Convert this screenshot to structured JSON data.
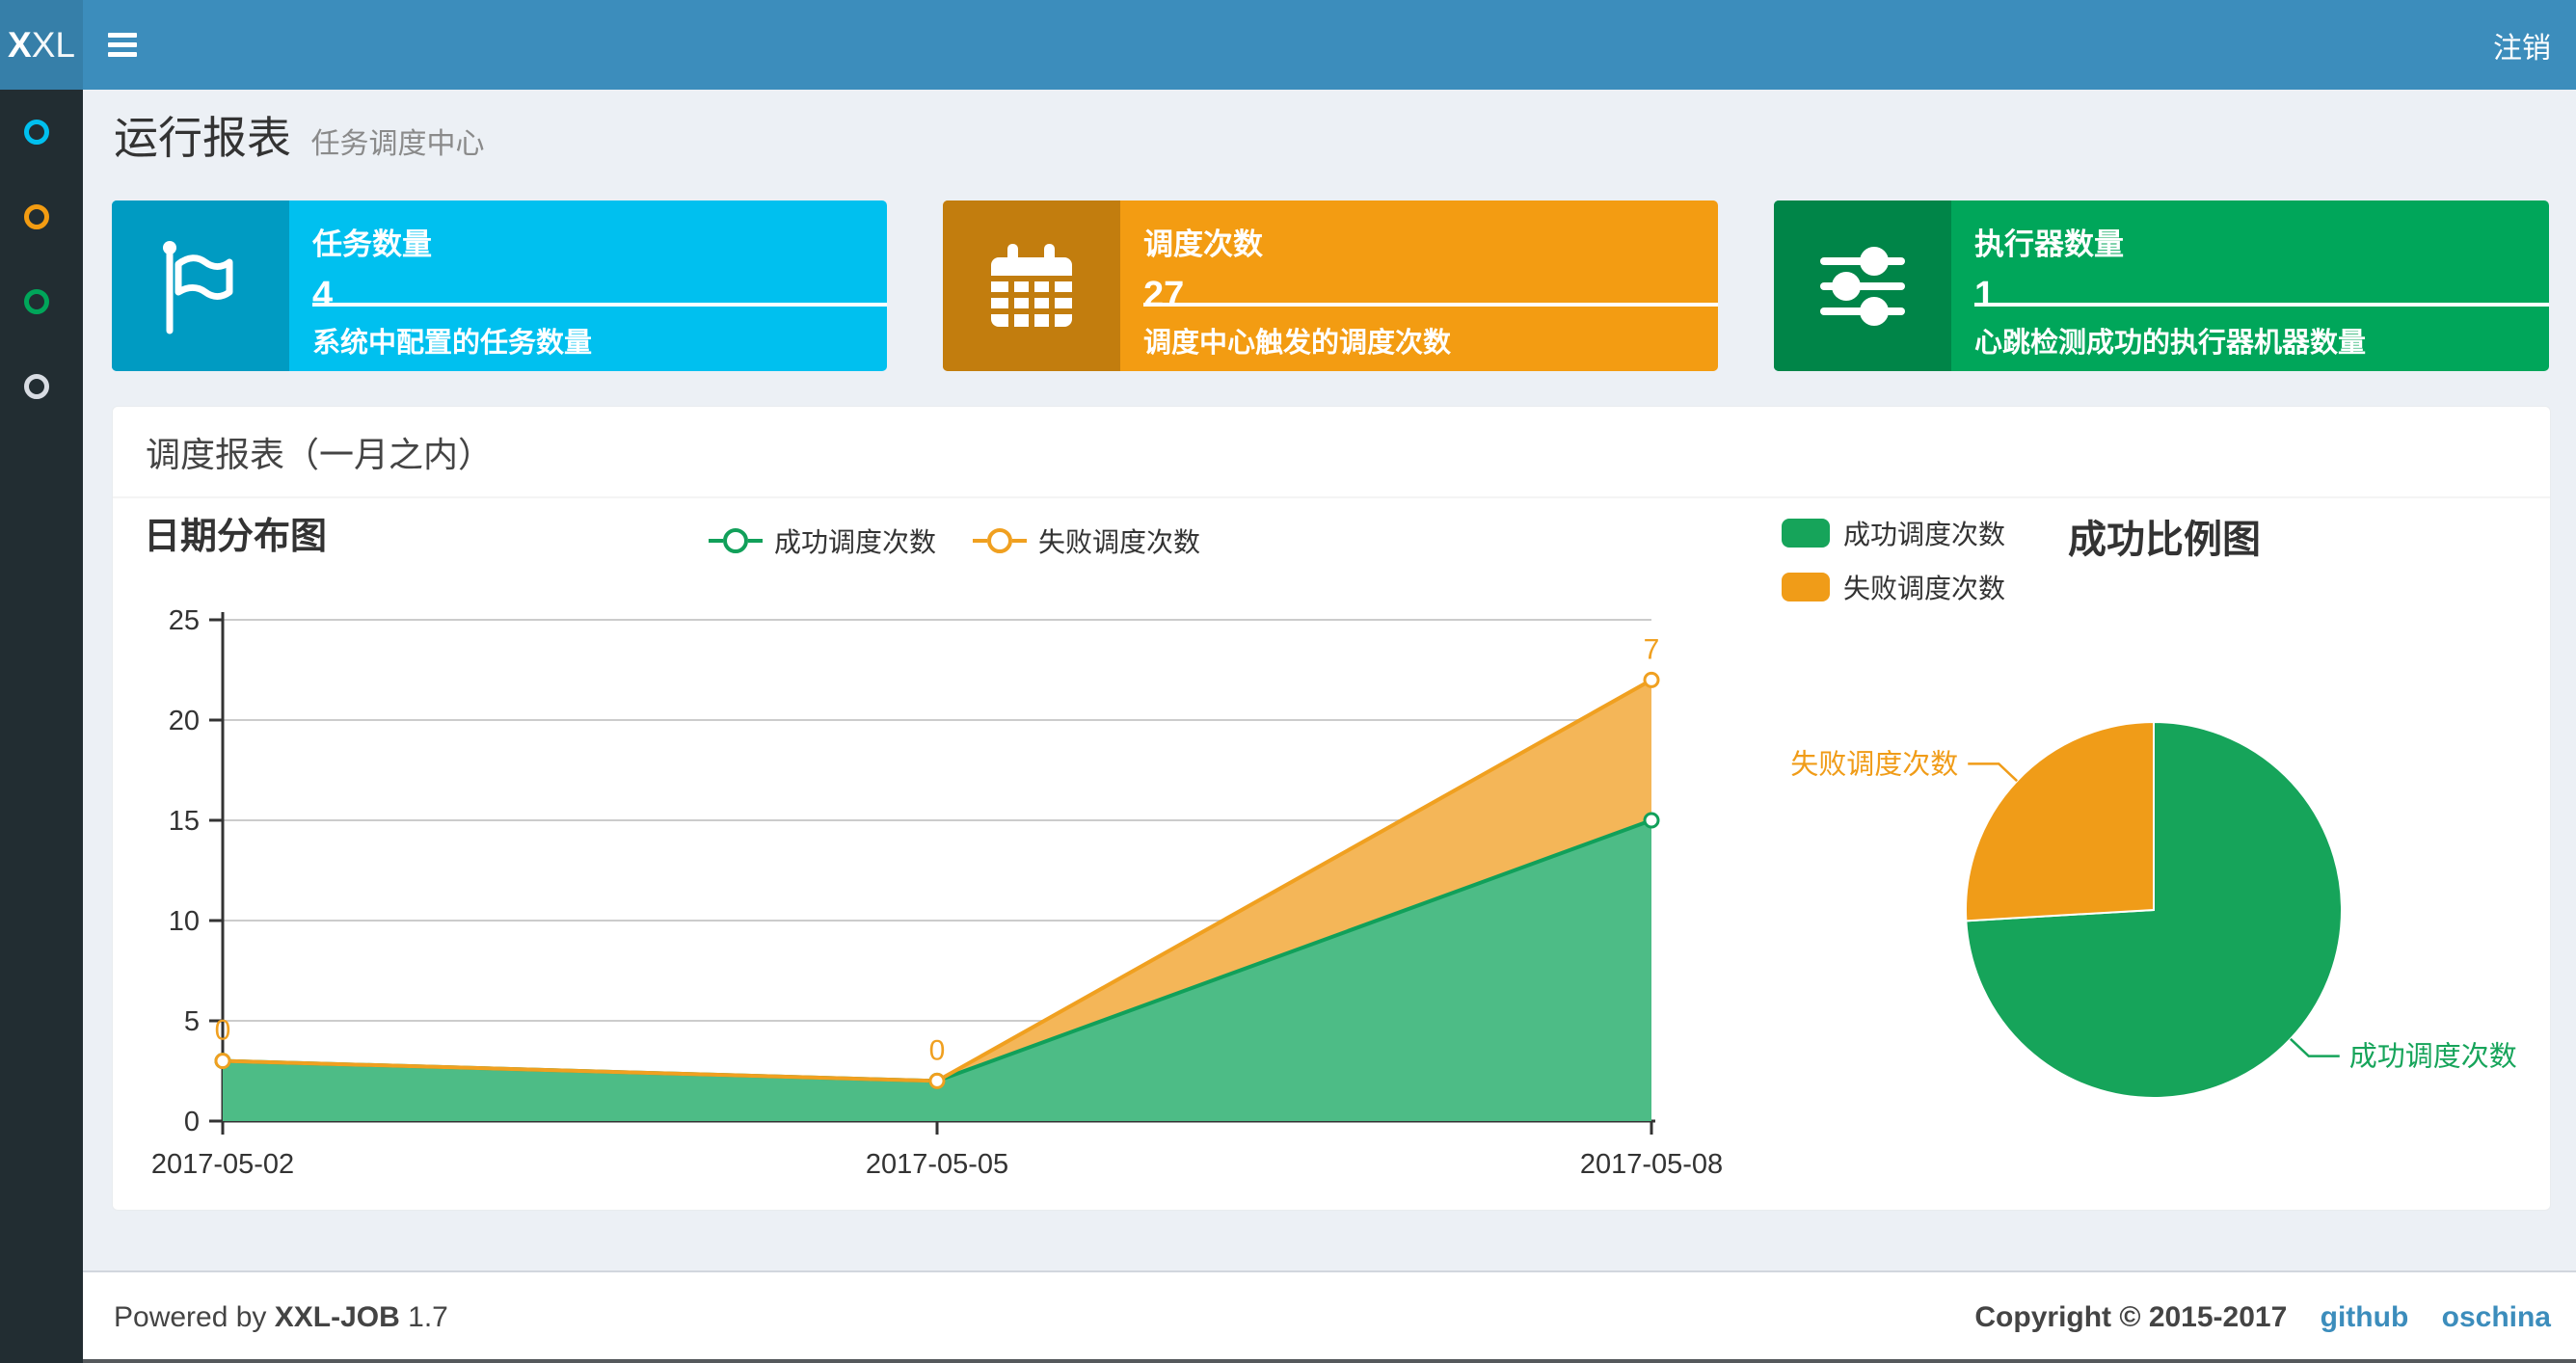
{
  "navbar": {
    "logo": {
      "bold": "X",
      "light": "XL"
    },
    "logout_label": "注销"
  },
  "sidebar": {
    "items": [
      {
        "id": "menu-run-report",
        "color": "#00c0ef"
      },
      {
        "id": "menu-job-manage",
        "color": "#f39c12"
      },
      {
        "id": "menu-log-manage",
        "color": "#00a65a"
      },
      {
        "id": "menu-executor-manage",
        "color": "#d8dce3"
      }
    ]
  },
  "page_header": {
    "title": "运行报表",
    "subtitle": "任务调度中心"
  },
  "stat_boxes": [
    {
      "label": "任务数量",
      "value": "4",
      "desc": "系统中配置的任务数量",
      "color": "#00c0ef",
      "icon_bg": "#009bc2",
      "icon": "flag-icon"
    },
    {
      "label": "调度次数",
      "value": "27",
      "desc": "调度中心触发的调度次数",
      "color": "#f39c12",
      "icon_bg": "#c27d0e",
      "icon": "calendar-icon"
    },
    {
      "label": "执行器数量",
      "value": "1",
      "desc": "心跳检测成功的执行器机器数量",
      "color": "#00a65a",
      "icon_bg": "#008548",
      "icon": "sliders-icon"
    }
  ],
  "panel": {
    "title": "调度报表（一月之内）"
  },
  "chart_data": [
    {
      "type": "area",
      "title": "日期分布图",
      "categories": [
        "2017-05-02",
        "2017-05-05",
        "2017-05-08"
      ],
      "series": [
        {
          "name": "成功调度次数",
          "values": [
            3,
            2,
            15
          ],
          "color": "#11a05a",
          "area_color": "#4dbc86",
          "show_labels": false
        },
        {
          "name": "失败调度次数",
          "values": [
            0,
            0,
            7
          ],
          "color": "#f0a020",
          "area_color": "#f4b658",
          "show_labels": true
        }
      ],
      "stacked": true,
      "ylim": [
        0,
        25
      ],
      "ytick_step": 5,
      "grid": true,
      "legend_position": "top-center"
    },
    {
      "type": "pie",
      "title": "成功比例图",
      "slices": [
        {
          "name": "成功调度次数",
          "value": 20,
          "color": "#16a45a"
        },
        {
          "name": "失败调度次数",
          "value": 7,
          "color": "#f09c18"
        }
      ],
      "legend_position": "top-left"
    }
  ],
  "footer": {
    "powered_prefix": "Powered by",
    "brand": "XXL-JOB",
    "version": "1.7",
    "copyright": "Copyright © 2015-2017",
    "links": [
      {
        "label": "github"
      },
      {
        "label": "oschina"
      }
    ]
  }
}
